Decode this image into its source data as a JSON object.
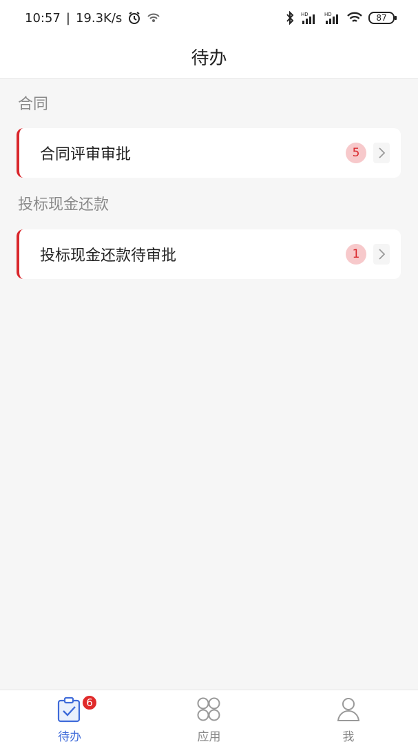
{
  "status_bar": {
    "time": "10:57",
    "net_speed": "19.3K/s",
    "battery": "87",
    "signal1_label": "HD",
    "signal2_label": "HD"
  },
  "header": {
    "title": "待办"
  },
  "sections": [
    {
      "title": "合同",
      "item_label": "合同评审审批",
      "count": "5"
    },
    {
      "title": "投标现金还款",
      "item_label": "投标现金还款待审批",
      "count": "1"
    }
  ],
  "tabbar": {
    "tabs": [
      {
        "label": "待办",
        "icon": "clipboard-check-icon",
        "badge": "6",
        "active": true
      },
      {
        "label": "应用",
        "icon": "apps-grid-icon"
      },
      {
        "label": "我",
        "icon": "user-icon"
      }
    ]
  },
  "colors": {
    "accent_red": "#d9272c",
    "active_blue": "#3f6bd9",
    "badge_bg": "#f7c9cb"
  }
}
